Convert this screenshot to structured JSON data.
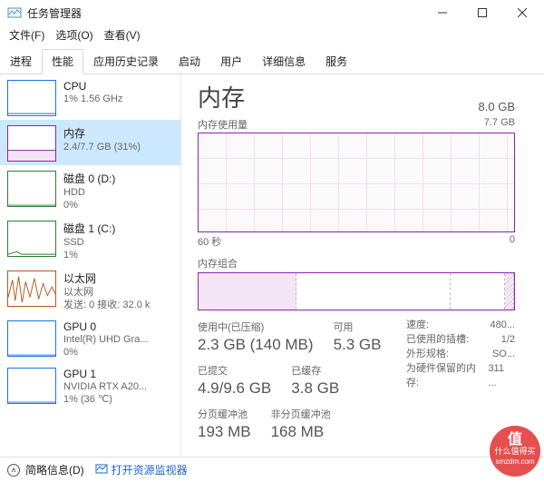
{
  "window": {
    "title": "任务管理器"
  },
  "menu": {
    "file": "文件(F)",
    "options": "选项(O)",
    "view": "查看(V)"
  },
  "tabs": {
    "proc": "进程",
    "perf": "性能",
    "hist": "应用历史记录",
    "startup": "启动",
    "users": "用户",
    "details": "详细信息",
    "services": "服务"
  },
  "sidebar": {
    "cpu": {
      "name": "CPU",
      "sub": "1%  1.56 GHz",
      "color": "#1a73e8"
    },
    "mem": {
      "name": "内存",
      "sub": "2.4/7.7 GB (31%)",
      "color": "#8e24aa"
    },
    "disk0": {
      "name": "磁盘 0 (D:)",
      "sub1": "HDD",
      "sub2": "0%",
      "color": "#2e7d32"
    },
    "disk1": {
      "name": "磁盘 1 (C:)",
      "sub1": "SSD",
      "sub2": "1%",
      "color": "#2e7d32"
    },
    "eth": {
      "name": "以太网",
      "sub1": "以太网",
      "sub2": "发送: 0 接收: 32.0 k",
      "color": "#b35a1e"
    },
    "gpu0": {
      "name": "GPU 0",
      "sub1": "Intel(R) UHD Gra...",
      "sub2": "0%",
      "color": "#1a73e8"
    },
    "gpu1": {
      "name": "GPU 1",
      "sub1": "NVIDIA RTX A20...",
      "sub2": "1% (36 ℃)",
      "color": "#1a73e8"
    }
  },
  "main": {
    "title": "内存",
    "total": "8.0 GB",
    "usage_label": "内存使用量",
    "usage_max": "7.7 GB",
    "axis_left": "60 秒",
    "axis_right": "0",
    "comp_label": "内存组合",
    "composition": {
      "used_pct": 31,
      "standby_pct": 49,
      "free_pct": 17,
      "reserved_pct": 3
    },
    "metrics": {
      "in_use_label": "使用中(已压缩)",
      "in_use": "2.3 GB (140 MB)",
      "avail_label": "可用",
      "avail": "5.3 GB",
      "committed_label": "已提交",
      "committed": "4.9/9.6 GB",
      "cached_label": "已缓存",
      "cached": "3.8 GB",
      "paged_label": "分页缓冲池",
      "paged": "193 MB",
      "nonpaged_label": "非分页缓冲池",
      "nonpaged": "168 MB"
    },
    "specs": {
      "speed_label": "速度:",
      "speed": "480...",
      "slots_label": "已使用的插槽:",
      "slots": "1/2",
      "form_label": "外形规格:",
      "form": "SO...",
      "hw_label": "为硬件保留的内存:",
      "hw": "311 ..."
    }
  },
  "footer": {
    "fewer": "简略信息(D)",
    "open_resmon": "打开资源监视器"
  },
  "chart_data": {
    "type": "line",
    "title": "内存使用量",
    "xlabel": "秒",
    "ylabel": "GB",
    "ylim": [
      0,
      7.7
    ],
    "xrange_seconds": 60,
    "series": [
      {
        "name": "内存",
        "values": [
          3.3,
          3.3,
          2.4,
          2.4,
          2.4,
          2.4,
          2.4,
          2.4,
          2.4,
          2.4,
          2.4,
          2.4,
          2.4,
          2.4,
          2.4,
          2.4,
          2.4,
          2.4,
          2.4,
          2.4,
          2.4,
          2.4,
          2.4,
          2.4,
          2.4,
          2.4,
          2.4,
          2.4,
          2.4,
          2.4,
          2.4,
          2.4,
          2.4,
          2.4,
          2.4,
          2.4,
          2.4,
          2.4,
          2.4,
          2.4,
          2.4,
          2.4,
          2.4,
          2.4,
          2.4,
          2.4,
          2.4,
          2.4,
          2.4,
          2.4,
          2.4,
          2.4,
          2.4,
          2.4,
          2.4,
          2.4,
          2.4,
          2.4,
          2.4,
          2.4
        ]
      }
    ]
  },
  "watermark": {
    "line1": "值",
    "line2": "什么值得买",
    "line3": "smzdm.com"
  }
}
